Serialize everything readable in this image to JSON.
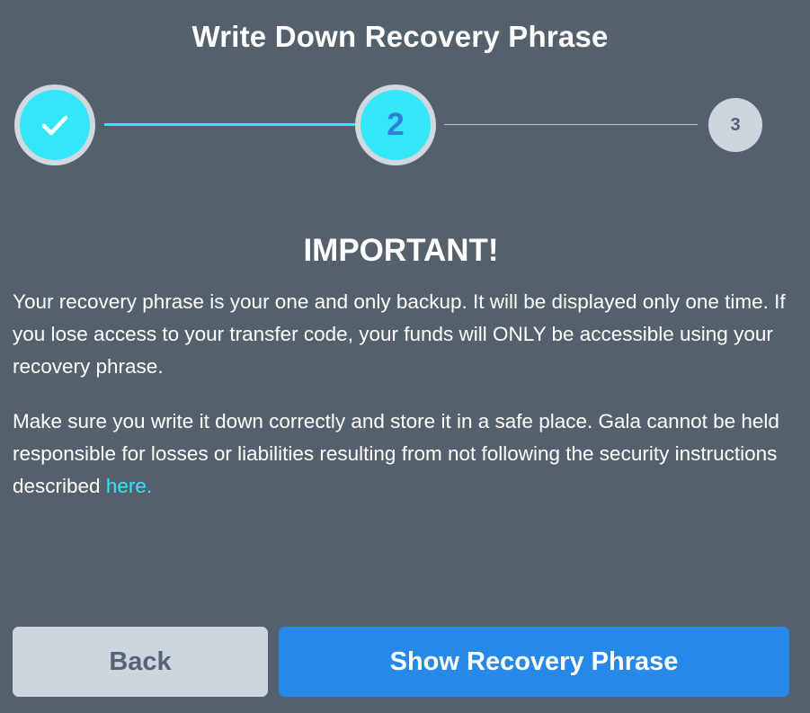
{
  "title": "Write Down Recovery Phrase",
  "stepper": {
    "steps": [
      {
        "label": "",
        "state": "completed",
        "icon": "checkmark-icon"
      },
      {
        "label": "2",
        "state": "current"
      },
      {
        "label": "3",
        "state": "upcoming"
      }
    ],
    "active_color": "#33e6f9"
  },
  "notice": {
    "heading": "IMPORTANT!",
    "paragraph1": "Your recovery phrase is your one and only backup. It will be displayed only one time. If you lose access to your transfer code, your funds will ONLY be accessible using your recovery phrase.",
    "paragraph2_text": "Make sure you write it down correctly and store it in a safe place. Gala cannot be held responsible for losses or liabilities resulting from not following the security instructions described ",
    "paragraph2_link": "here."
  },
  "buttons": {
    "back_label": "Back",
    "show_label": "Show Recovery Phrase"
  },
  "colors": {
    "background": "#54616c",
    "primary": "#2689ea",
    "accent": "#33e6f9"
  }
}
